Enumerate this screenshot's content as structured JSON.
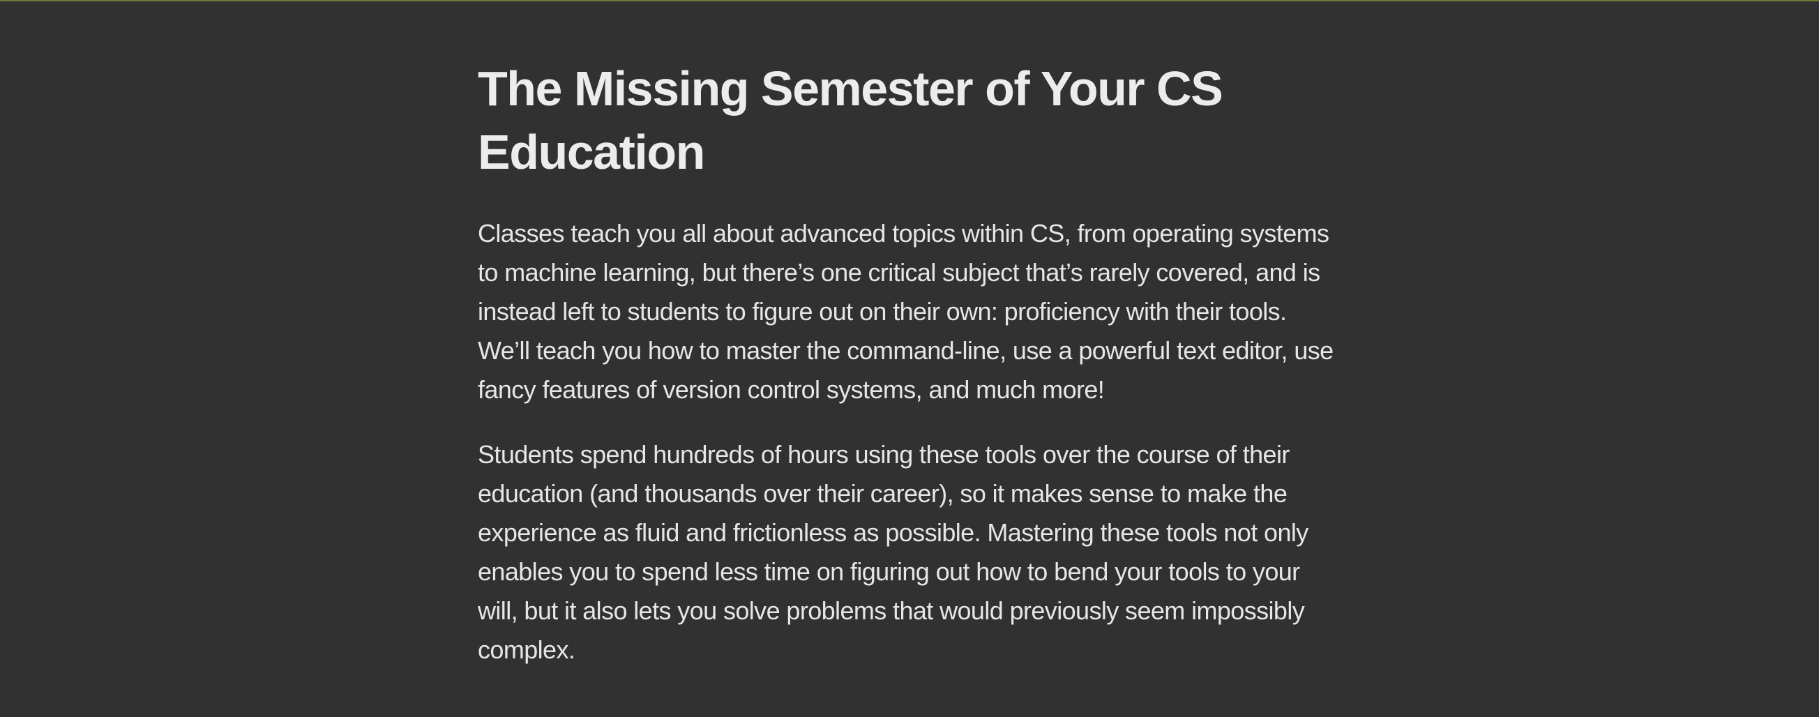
{
  "page": {
    "title": "The Missing Semester of Your CS Education",
    "paragraphs": [
      "Classes teach you all about advanced topics within CS, from operating systems to machine learning, but there’s one critical subject that’s rarely covered, and is instead left to students to figure out on their own: proficiency with their tools. We’ll teach you how to master the command-line, use a powerful text editor, use fancy features of version control systems, and much more!",
      "Students spend hundreds of hours using these tools over the course of their education (and thousands over their career), so it makes sense to make the experience as fluid and frictionless as possible. Mastering these tools not only enables you to spend less time on figuring out how to bend your tools to your will, but it also lets you solve problems that would previously seem impossibly complex."
    ]
  },
  "colors": {
    "background": "#313131",
    "text": "#ebebeb",
    "top_border": "#6f7a3a"
  }
}
